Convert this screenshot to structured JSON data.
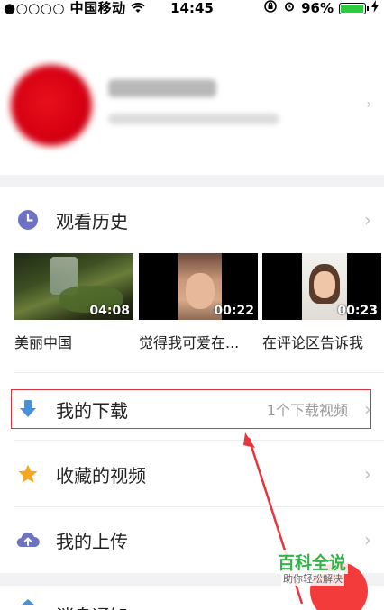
{
  "status_bar": {
    "carrier": "●○○○○ 中国移动",
    "time": "14:45",
    "battery": "96%",
    "battery_level": 0.96
  },
  "history": {
    "title": "观看历史",
    "videos": [
      {
        "duration": "04:08",
        "caption": "美丽中国"
      },
      {
        "duration": "00:22",
        "caption": "觉得我可爱在..."
      },
      {
        "duration": "00:23",
        "caption": "在评论区告诉我"
      }
    ]
  },
  "downloads": {
    "title": "我的下载",
    "meta": "1个下载视频"
  },
  "favorites": {
    "title": "收藏的视频"
  },
  "uploads": {
    "title": "我的上传"
  },
  "next_row": {
    "title": "消息通知"
  },
  "watermark": {
    "title": "百科全说",
    "subtitle": "助你轻松解决"
  },
  "colors": {
    "highlight": "#d9343a",
    "history_icon": "#6e72c2",
    "download_icon": "#4a90d9",
    "favorite_icon": "#f5a623",
    "upload_icon": "#6e72c2"
  }
}
